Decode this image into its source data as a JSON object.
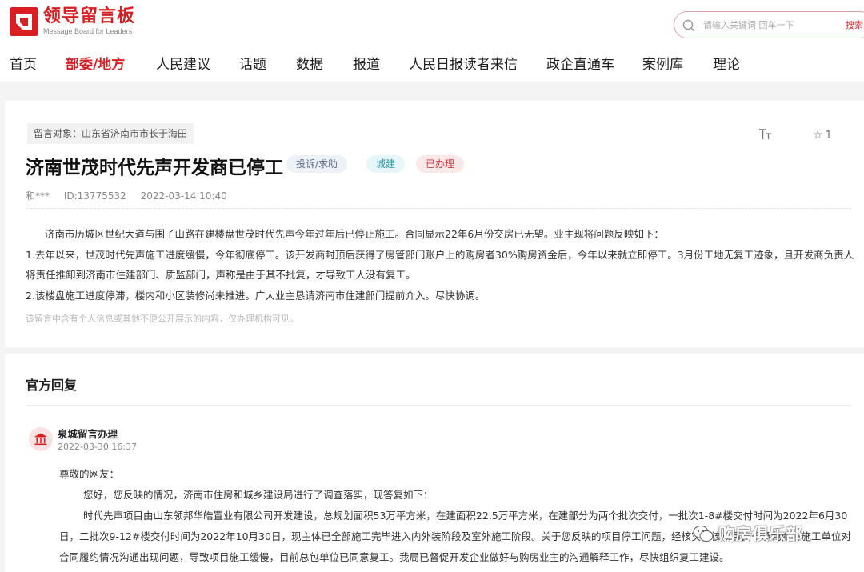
{
  "header": {
    "logo_title": "领导留言板",
    "logo_subtitle": "Message Board for Leaders",
    "search_placeholder": "请输入关键词 回车一下",
    "search_button": "搜索"
  },
  "nav": [
    {
      "label": "首页",
      "active": false
    },
    {
      "label": "部委/地方",
      "active": true
    },
    {
      "label": "人民建议",
      "active": false
    },
    {
      "label": "话题",
      "active": false
    },
    {
      "label": "数据",
      "active": false
    },
    {
      "label": "报道",
      "active": false
    },
    {
      "label": "人民日报读者来信",
      "active": false
    },
    {
      "label": "政企直通车",
      "active": false
    },
    {
      "label": "案例库",
      "active": false
    },
    {
      "label": "理论",
      "active": false
    }
  ],
  "message": {
    "target": "留言对象：山东省济南市市长于海田",
    "font_size_icon": "TT",
    "favorite_count": "1",
    "title": "济南世茂时代先声开发商已停工",
    "badges": {
      "type": "投诉/求助",
      "category": "城建",
      "status": "已办理"
    },
    "author": "和***",
    "id": "ID:13775532",
    "datetime": "2022-03-14 10:40",
    "paragraphs": [
      "济南市历城区世纪大道与围子山路在建楼盘世茂时代先声今年过年后已停止施工。合同显示22年6月份交房已无望。业主现将问题反映如下：",
      "1.去年以来，世茂时代先声施工进度缓慢，今年彻底停工。该开发商封顶后获得了房管部门账户上的购房者30%购房资金后，今年以来就立即停工。3月份工地无复工迹象，且开发商负责人将责任推卸到济南市住建部门、质监部门，声称是由于其不批复，才导致工人没有复工。",
      "2.该楼盘施工进度停滞，楼内和小区装修尚未推进。广大业主恳请济南市住建部门提前介入。尽快协调。"
    ],
    "notice": "该留言中含有个人信息或其他不便公开展示的内容，仅办理机构可见。"
  },
  "reply": {
    "section_title": "官方回复",
    "replier": "泉城留言办理",
    "date": "2022-03-30 16:37",
    "greeting": "尊敬的网友：",
    "paragraphs": [
      "您好，您反映的情况，济南市住房和城乡建设局进行了调查落实，现答复如下：",
      "时代先声项目由山东领邦华皓置业有限公司开发建设，总规划面积53万平方米，在建面积22.5万平方米，在建部分为两个批次交付，一批次1-8#楼交付时间为2022年6月30日，二批次9-12#楼交付时间为2022年10月30日，现主体已全部施工完毕进入内外装阶段及室外施工阶段。关于您反映的项目停工问题，经核实，该项目由于承包商与施工单位对合同履约情况沟通出现问题，导致项目施工缓慢，目前总包单位已同意复工。我局已督促开发企业做好与购房业主的沟通解释工作，尽快组织复工建设。"
    ]
  },
  "watermark": "购房俱乐部",
  "colors": {
    "brand": "#d71f24",
    "background": "#f4f4f4"
  }
}
